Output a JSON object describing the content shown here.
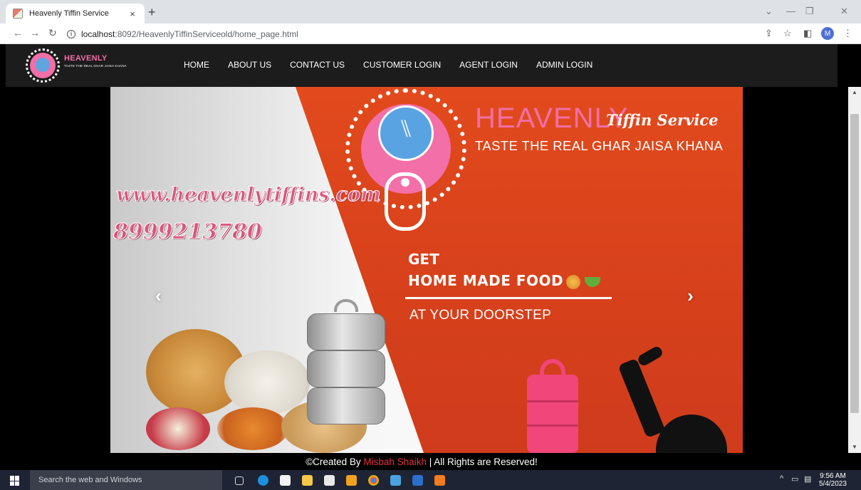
{
  "browser": {
    "tab_title": "Heavenly Tiffin Service",
    "tab_close": "×",
    "new_tab": "+",
    "url_host": "localhost",
    "url_path": ":8092/HeavenlyTiffinServiceold/home_page.html",
    "profile_initial": "M"
  },
  "site": {
    "logo_name": "HEAVENLY",
    "logo_script": "Tiffin Service",
    "logo_tagline": "TASTE THE REAL GHAR JAISA KHANA",
    "nav": [
      "HOME",
      "ABOUT US",
      "CONTACT US",
      "CUSTOMER LOGIN",
      "AGENT LOGIN",
      "ADMIN LOGIN"
    ]
  },
  "banner": {
    "brand_name": "HEAVENLY",
    "brand_script": "Tiffin Service",
    "brand_tagline": "TASTE THE REAL GHAR JAISA KHANA",
    "website": "www.heavenlytiffins.com",
    "phone": "8999213780",
    "line1": "GET",
    "line2": "HOME MADE FOOD",
    "line3": "AT YOUR DOORSTEP",
    "prev_arrow": "‹",
    "next_arrow": "›"
  },
  "footer": {
    "prefix": "©Created By ",
    "author": "Misbah Shaikh",
    "suffix": " | All Rights are Reserved!"
  },
  "taskbar": {
    "search_placeholder": "Search the web and Windows",
    "time": "9:56 AM",
    "date": "5/4/2023"
  },
  "colors": {
    "brand_pink": "#f06fa7",
    "banner_red": "#d94522",
    "author_red": "#e5323f",
    "navbar_bg": "#1c1c1c"
  }
}
